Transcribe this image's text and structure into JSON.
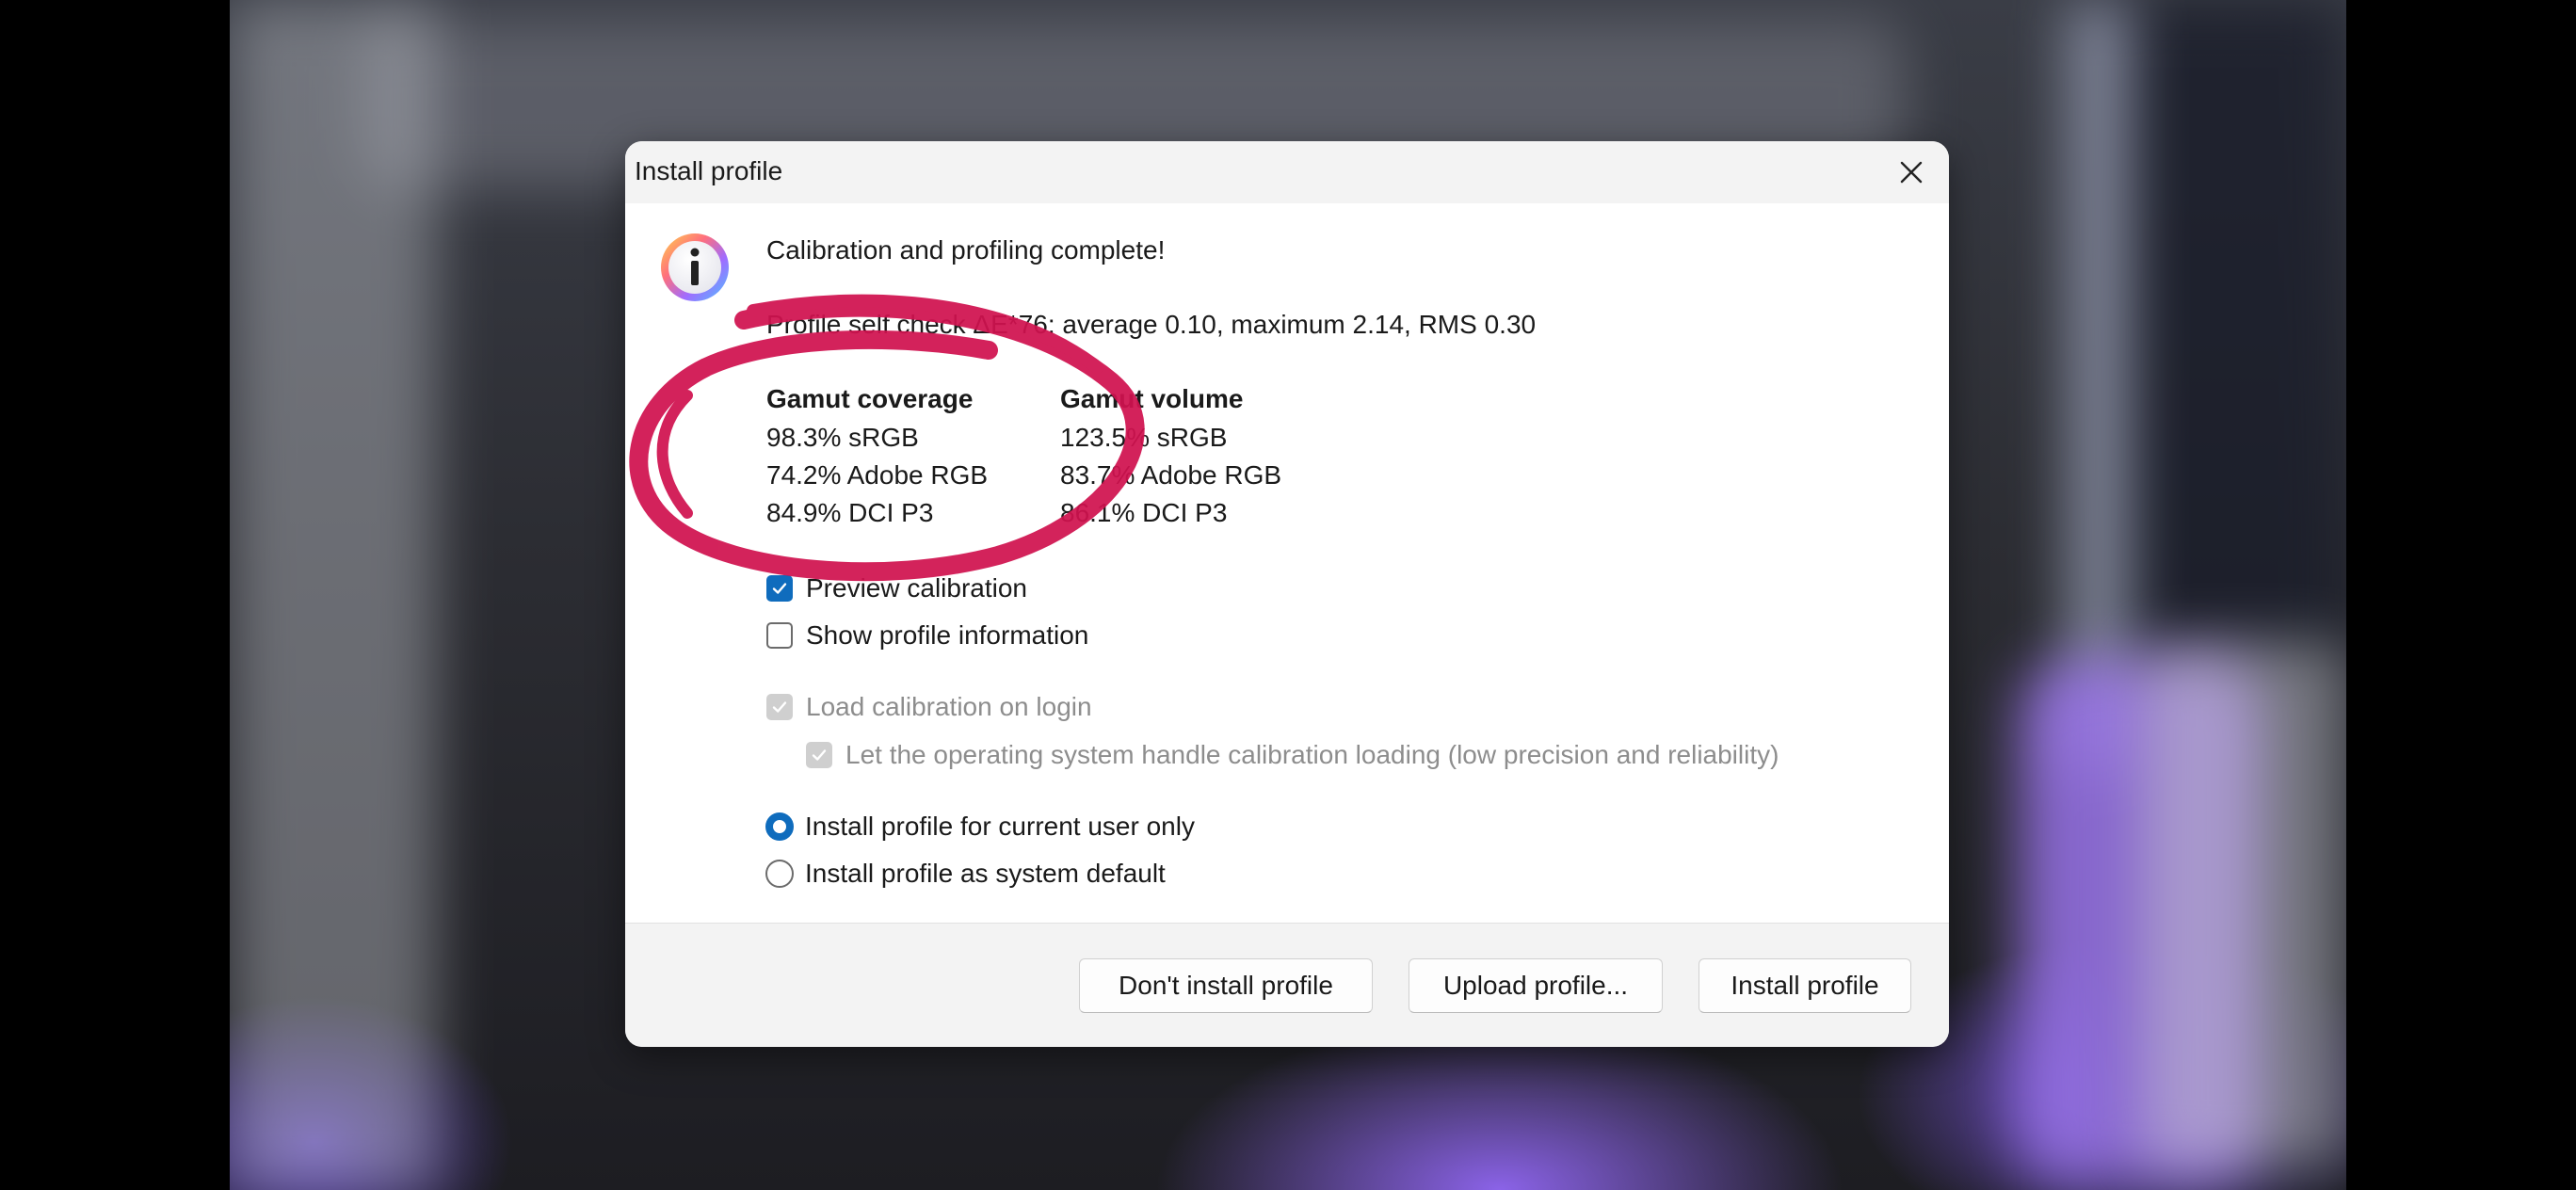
{
  "dialog": {
    "title": "Install profile",
    "heading": "Calibration and profiling complete!",
    "selfcheck_line": "Profile self check ΔE*76: average 0.10, maximum 2.14, RMS 0.30",
    "gamut": {
      "coverage_header": "Gamut coverage",
      "volume_header": "Gamut volume",
      "coverage": [
        "98.3% sRGB",
        "74.2% Adobe RGB",
        "84.9% DCI P3"
      ],
      "volume": [
        "123.5% sRGB",
        "83.7% Adobe RGB",
        "86.1% DCI P3"
      ]
    },
    "options": {
      "preview_calibration": "Preview calibration",
      "show_profile_info": "Show profile information",
      "load_on_login": "Load calibration on login",
      "os_handle": "Let the operating system handle calibration loading (low precision and reliability)",
      "current_user": "Install profile for current user only",
      "system_default": "Install profile as system default"
    },
    "buttons": {
      "dont_install": "Don't install profile",
      "upload": "Upload profile...",
      "install": "Install profile"
    }
  },
  "colors": {
    "accent": "#0f6cbd",
    "marker": "#d0124f"
  },
  "icons": {
    "info": "info-icon",
    "close": "close-icon",
    "check": "checkmark-icon"
  }
}
